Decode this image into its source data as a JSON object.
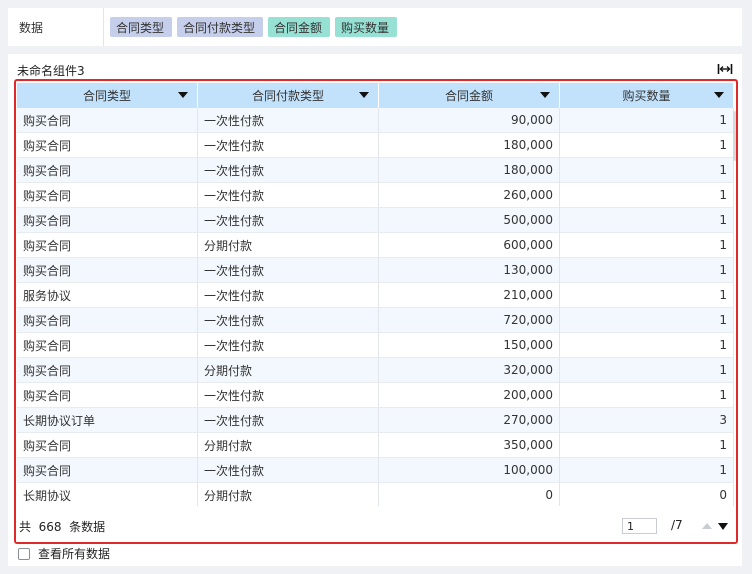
{
  "data_panel": {
    "label": "数据",
    "fields": [
      {
        "label": "合同类型",
        "kind": "dimension",
        "color": "#c5cfec"
      },
      {
        "label": "合同付款类型",
        "kind": "dimension",
        "color": "#c5cfec"
      },
      {
        "label": "合同金额",
        "kind": "measure",
        "color": "#96e0d4"
      },
      {
        "label": "购买数量",
        "kind": "measure",
        "color": "#96e0d4"
      }
    ]
  },
  "component": {
    "title": "未命名组件3",
    "expand_icon": "expand-width-icon"
  },
  "table": {
    "columns": [
      "合同类型",
      "合同付款类型",
      "合同金额",
      "购买数量"
    ],
    "rows": [
      [
        "购买合同",
        "一次性付款",
        "90,000",
        "1"
      ],
      [
        "购买合同",
        "一次性付款",
        "180,000",
        "1"
      ],
      [
        "购买合同",
        "一次性付款",
        "180,000",
        "1"
      ],
      [
        "购买合同",
        "一次性付款",
        "260,000",
        "1"
      ],
      [
        "购买合同",
        "一次性付款",
        "500,000",
        "1"
      ],
      [
        "购买合同",
        "分期付款",
        "600,000",
        "1"
      ],
      [
        "购买合同",
        "一次性付款",
        "130,000",
        "1"
      ],
      [
        "服务协议",
        "一次性付款",
        "210,000",
        "1"
      ],
      [
        "购买合同",
        "一次性付款",
        "720,000",
        "1"
      ],
      [
        "购买合同",
        "一次性付款",
        "150,000",
        "1"
      ],
      [
        "购买合同",
        "分期付款",
        "320,000",
        "1"
      ],
      [
        "购买合同",
        "一次性付款",
        "200,000",
        "1"
      ],
      [
        "长期协议订单",
        "一次性付款",
        "270,000",
        "3"
      ],
      [
        "购买合同",
        "分期付款",
        "350,000",
        "1"
      ],
      [
        "购买合同",
        "一次性付款",
        "100,000",
        "1"
      ],
      [
        "长期协议",
        "分期付款",
        "0",
        "0"
      ]
    ],
    "header_color": "#c2e1fb",
    "stripe_color": "#f2f8fd",
    "highlight_border_color": "#e02a2a"
  },
  "footer": {
    "total_text": "共  668  条数据",
    "current_page": "1",
    "total_pages": "/7"
  },
  "view_all_label": "查看所有数据"
}
